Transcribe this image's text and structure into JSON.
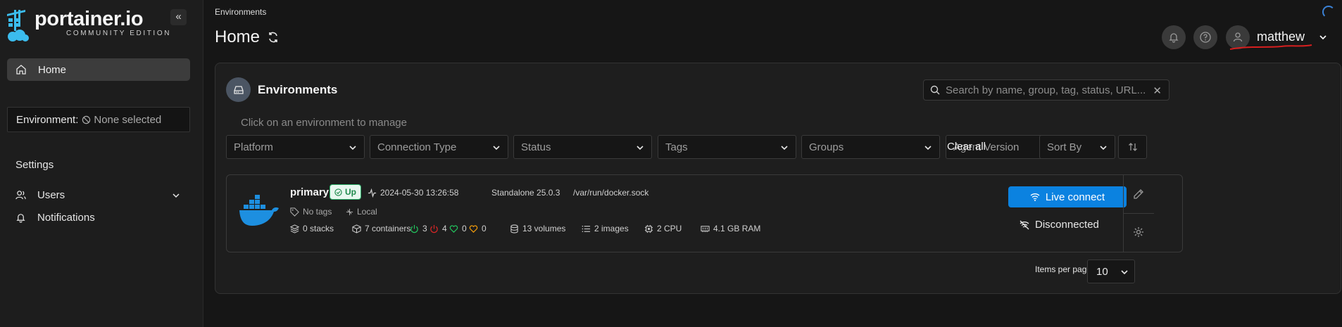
{
  "sidebar": {
    "logo_text": "portainer.io",
    "logo_subtitle": "COMMUNITY EDITION",
    "collapse_label": "«",
    "home_label": "Home",
    "environment_label": "Environment:",
    "environment_value": "None selected",
    "settings_label": "Settings",
    "users_label": "Users",
    "notifications_label": "Notifications"
  },
  "header": {
    "breadcrumb": "Environments",
    "title": "Home",
    "username": "matthew"
  },
  "panel": {
    "title": "Environments",
    "search_placeholder": "Search by name, group, tag, status, URL...",
    "search_clear": "✕",
    "hint": "Click on an environment to manage",
    "filters": [
      "Platform",
      "Connection Type",
      "Status",
      "Tags",
      "Groups",
      "Agent Version"
    ],
    "clear_all": "Clear all",
    "sort_by": "Sort By",
    "items_per_page_label": "Items per page",
    "items_per_page_value": "10"
  },
  "environment": {
    "name": "primary",
    "status": "Up",
    "timestamp": "2024-05-30 13:26:58",
    "type": "Standalone 25.0.3",
    "socket": "/var/run/docker.sock",
    "tags": "No tags",
    "location": "Local",
    "stacks": "0 stacks",
    "containers": "7 containers",
    "running": "3",
    "stopped": "4",
    "healthy": "0",
    "unhealthy": "0",
    "volumes": "13 volumes",
    "images": "2 images",
    "cpu": "2 CPU",
    "ram": "4.1 GB RAM",
    "live_connect": "Live connect",
    "disconnected": "Disconnected"
  },
  "colors": {
    "accent_blue": "#0b82e0",
    "up_green": "#1f8a4c",
    "running_green": "#22c55e",
    "stopped_red": "#dc2626",
    "healthy_green": "#22c55e",
    "unhealthy_amber": "#f59e0b"
  },
  "icons": [
    "portainer-logo",
    "home-icon",
    "ban-icon",
    "users-icon",
    "bell-icon",
    "help-icon",
    "user-icon",
    "refresh-icon",
    "environments-icon",
    "search-icon",
    "docker-icon",
    "heartbeat-icon",
    "tag-icon",
    "location-icon",
    "stack-icon",
    "container-icon",
    "power-icon",
    "heart-icon",
    "volume-icon",
    "list-icon",
    "cpu-icon",
    "memory-icon",
    "wifi-icon",
    "wifi-off-icon",
    "edit-icon",
    "settings-icon",
    "sort-icon"
  ]
}
